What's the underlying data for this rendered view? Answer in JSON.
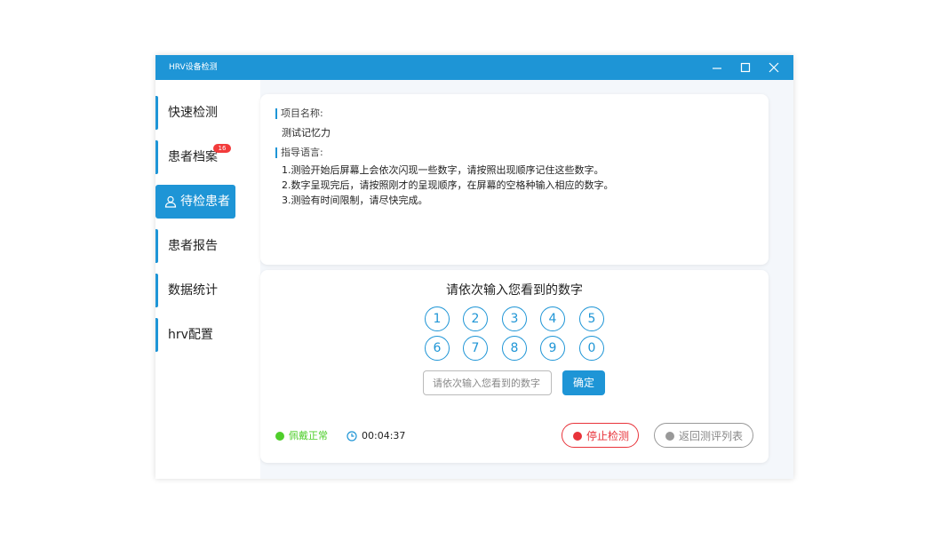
{
  "window": {
    "title": "HRV设备检测",
    "controls": {
      "minimize": "minimize-icon",
      "maximize": "maximize-icon",
      "close": "close-icon"
    }
  },
  "sidebar": {
    "items": [
      {
        "label": "快速检测",
        "active": false
      },
      {
        "label": "患者档案",
        "active": false,
        "badge": "16"
      },
      {
        "label": "待检患者",
        "active": true,
        "icon": "user-icon"
      },
      {
        "label": "患者报告",
        "active": false
      },
      {
        "label": "数据统计",
        "active": false
      },
      {
        "label": "hrv配置",
        "active": false
      }
    ]
  },
  "project": {
    "name_label": "项目名称:",
    "name_value": "测试记忆力",
    "guide_label": "指导语言:",
    "guide_lines": [
      "1.测验开始后屏幕上会依次闪现一些数字，请按照出现顺序记住这些数字。",
      "2.数字呈现完后，请按照刚才的呈现顺序，在屏幕的空格种输入相应的数字。",
      "3.测验有时间限制，请尽快完成。"
    ]
  },
  "test": {
    "prompt": "请依次输入您看到的数字",
    "digits": [
      "1",
      "2",
      "3",
      "4",
      "5",
      "6",
      "7",
      "8",
      "9",
      "0"
    ],
    "input_value": "",
    "input_placeholder": "请依次输入您看到的数字",
    "confirm_label": "确定"
  },
  "footer": {
    "wear_status": "佩戴正常",
    "timer": "00:04:37",
    "stop_label": "停止检测",
    "back_label": "返回测评列表"
  },
  "colors": {
    "accent": "#1e95d6",
    "wear_ok": "#4fce2b",
    "stop": "#e8333a",
    "disabled": "#999999",
    "badge": "#f23b3b"
  }
}
